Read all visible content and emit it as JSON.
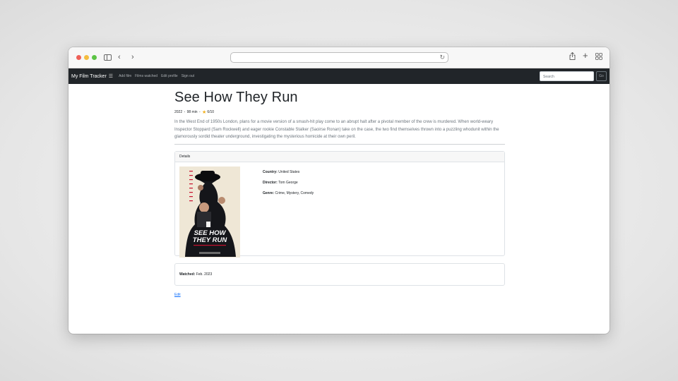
{
  "browser": {
    "icons": [
      "sidebar-icon",
      "chevron-left-icon",
      "chevron-right-icon",
      "reload-icon",
      "share-icon",
      "plus-icon",
      "tab-grid-icon"
    ]
  },
  "navbar": {
    "brand": "My Film Tracker",
    "brand_icon": "film-list-icon",
    "links": [
      "Add film",
      "Films watched",
      "Edit profile",
      "Sign out"
    ],
    "search_placeholder": "Search",
    "search_button": "Go"
  },
  "film": {
    "title": "See How They Run",
    "year": "2022",
    "runtime": "98 min",
    "rating": "6/10",
    "description": "In the West End of 1950s London, plans for a movie version of a smash-hit play come to an abrupt halt after a pivotal member of the crew is murdered. When world-weary Inspector Stoppard (Sam Rockwell) and eager rookie Constable Stalker (Saoirse Ronan) take on the case, the two find themselves thrown into a puzzling whodunit within the glamorously sordid theater underground, investigating the mysterious homicide at their own peril.",
    "details_header": "Details",
    "poster_text": [
      "SEE HOW",
      "THEY RUN"
    ],
    "country_label": "Country:",
    "country": "United States",
    "director_label": "Director:",
    "director": "Tom George",
    "genre_label": "Genre:",
    "genre": "Crime, Mystery, Comedy",
    "watched_label": "Watched:",
    "watched": "Feb. 2023",
    "edit_link": "Edit"
  },
  "colors": {
    "navbar_bg": "#212529",
    "link": "#0d6efd",
    "star": "#f2b01e",
    "poster_accent": "#c8102e"
  }
}
